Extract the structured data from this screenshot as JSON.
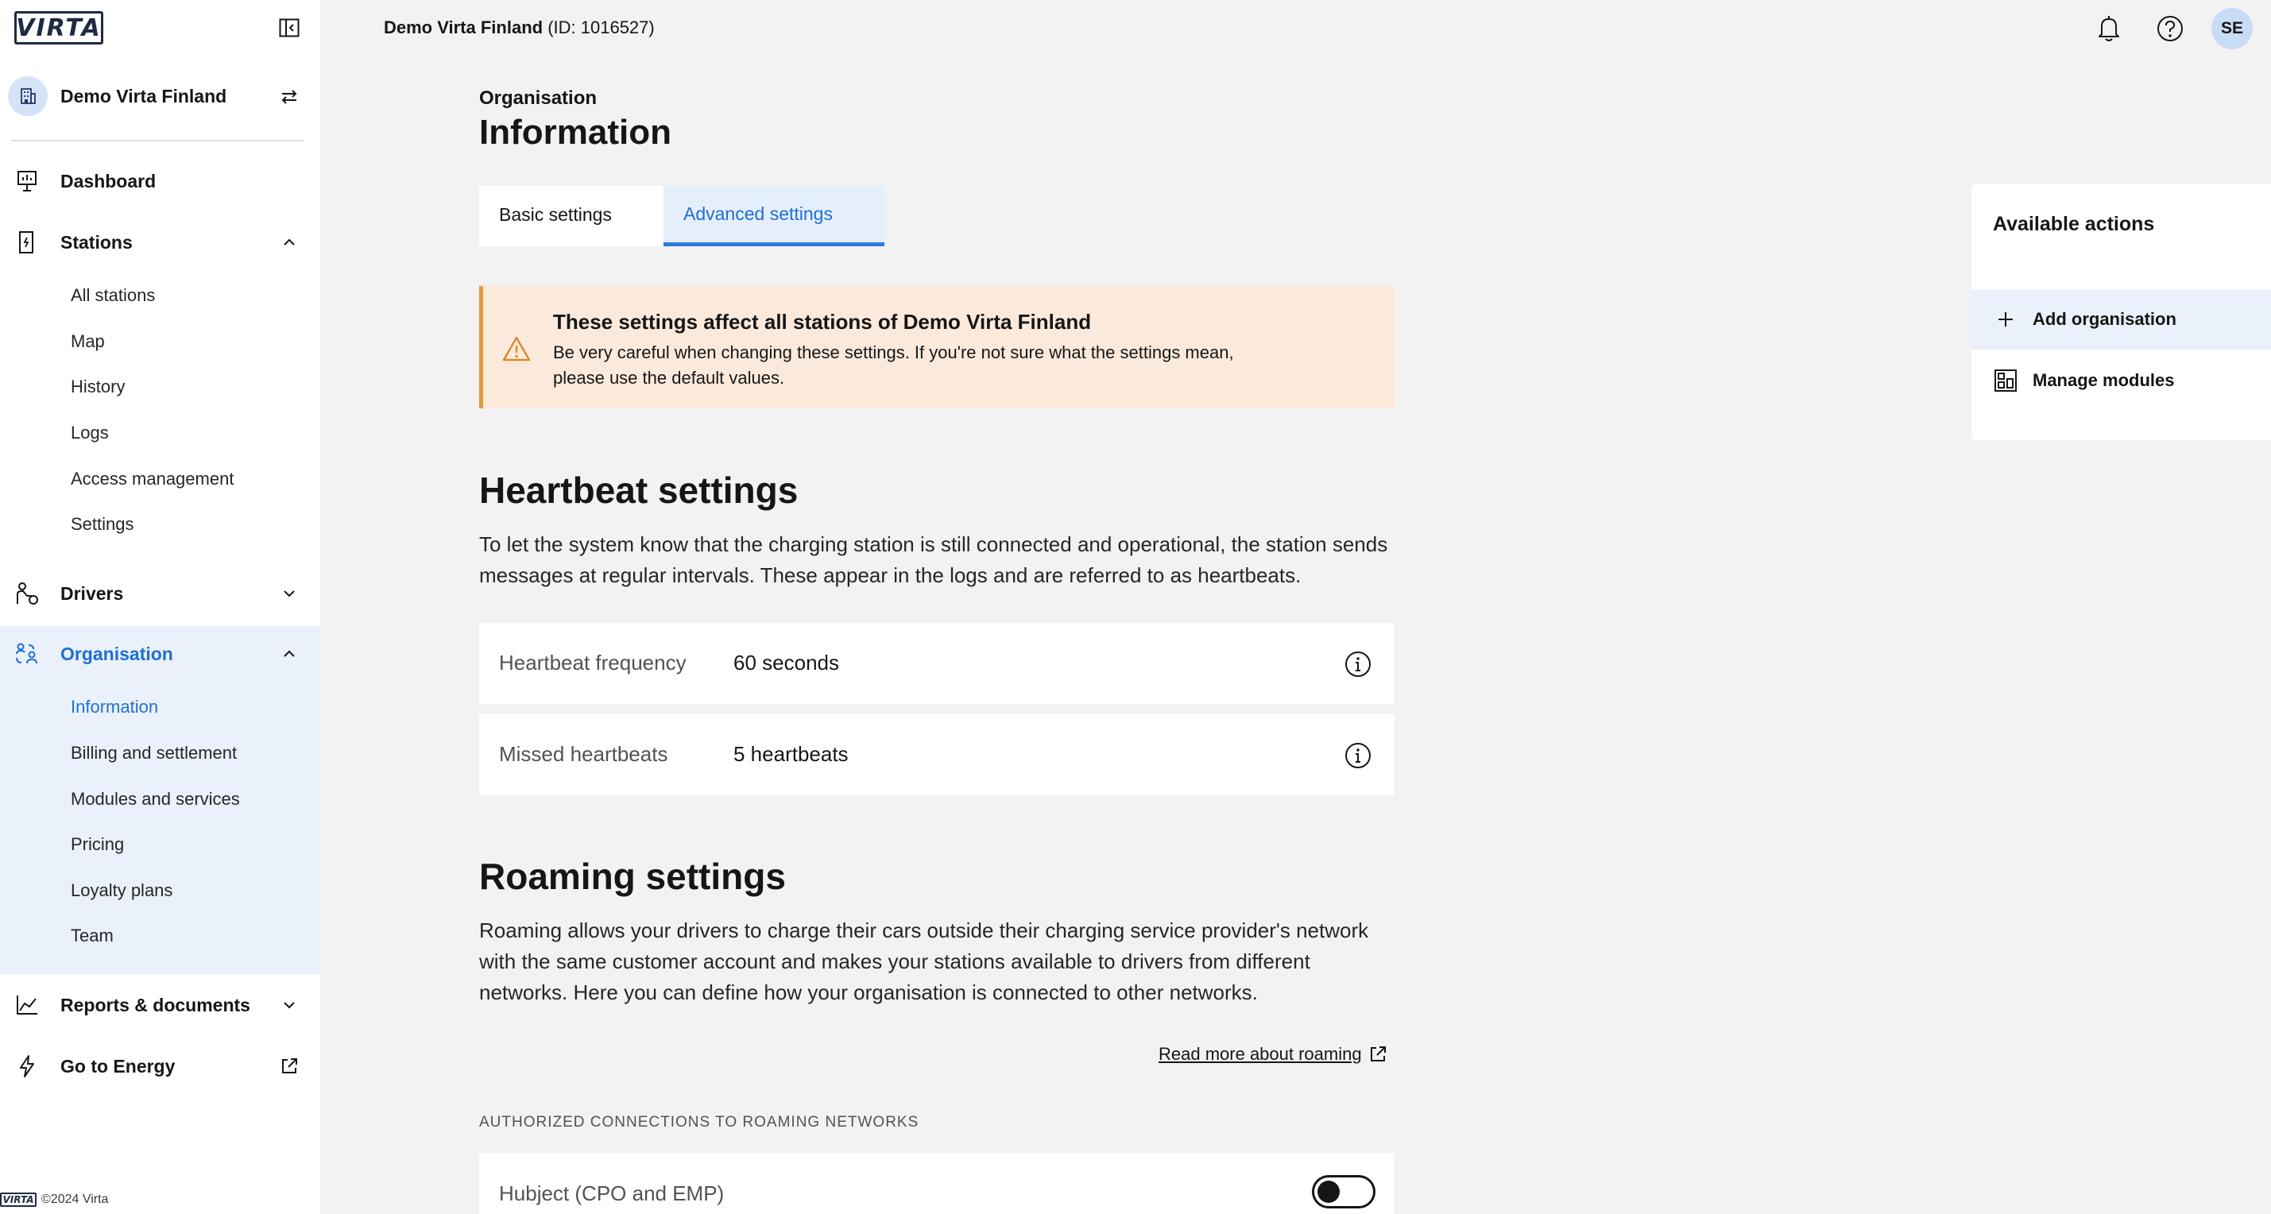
{
  "brand": {
    "logo_text": "VIRTA",
    "footer_text": "©2024 Virta",
    "accent": "#1f6fd6"
  },
  "sidebar": {
    "org_name": "Demo Virta Finland",
    "nav": {
      "dashboard": "Dashboard",
      "stations": "Stations",
      "stations_sub": [
        "All stations",
        "Map",
        "History",
        "Logs",
        "Access management",
        "Settings"
      ],
      "drivers": "Drivers",
      "organisation": "Organisation",
      "organisation_sub": [
        "Information",
        "Billing and settlement",
        "Modules and services",
        "Pricing",
        "Loyalty plans",
        "Team"
      ],
      "reports": "Reports & documents",
      "energy": "Go to Energy"
    }
  },
  "topbar": {
    "org_name": "Demo Virta Finland",
    "org_id": "(ID: 1016527)",
    "user_initials": "SE"
  },
  "main": {
    "breadcrumb": "Organisation",
    "title": "Information",
    "tabs": [
      {
        "label": "Basic settings",
        "active": false
      },
      {
        "label": "Advanced settings",
        "active": true
      }
    ],
    "warning": {
      "title": "These settings affect all stations of Demo Virta Finland",
      "text": "Be very careful when changing these settings. If you're not sure what the settings mean, please use the default values."
    },
    "heartbeat": {
      "heading": "Heartbeat settings",
      "description": "To let the system know that the charging station is still connected and operational, the station sends messages at regular intervals. These appear in the logs and are referred to as heartbeats.",
      "rows": [
        {
          "label": "Heartbeat frequency",
          "value": "60 seconds"
        },
        {
          "label": "Missed heartbeats",
          "value": "5 heartbeats"
        }
      ]
    },
    "roaming": {
      "heading": "Roaming settings",
      "description": "Roaming allows your drivers to charge their cars outside their charging service provider's network with the same customer account and makes your stations available to drivers from different networks. Here you can define how your organisation is connected to other networks.",
      "read_more": "Read more about roaming",
      "connections_label": "AUTHORIZED CONNECTIONS TO ROAMING NETWORKS",
      "connections": [
        {
          "label": "Hubject (CPO and EMP)",
          "enabled": false
        }
      ]
    }
  },
  "actions": {
    "title": "Available actions",
    "items": [
      "Add organisation",
      "Manage modules"
    ]
  }
}
